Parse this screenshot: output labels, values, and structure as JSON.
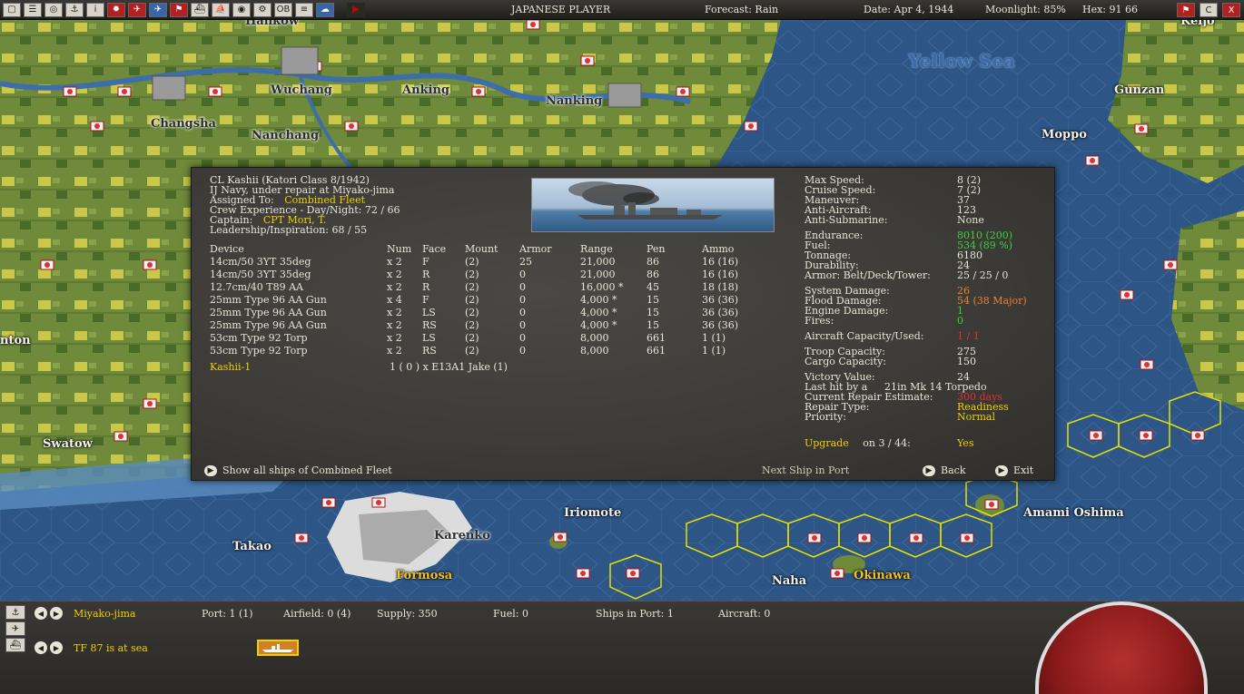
{
  "topbar": {
    "player": "JAPANESE PLAYER",
    "forecast": "Forecast: Rain",
    "date": "Date: Apr 4, 1944",
    "moonlight": "Moonlight: 85%",
    "hex": "Hex: 91  66",
    "buttons": [
      "menu-icon",
      "report-icon",
      "intel-icon",
      "tf-icon",
      "info-icon",
      "rising-sun-icon",
      "plane-icon",
      "ship-icon",
      "flag-icon",
      "carrier-icon",
      "sub-icon",
      "globe-icon",
      "gear-icon",
      "ob-icon",
      "list-icon",
      "cloud-icon",
      "play-icon"
    ],
    "right_buttons": [
      "flag-icon",
      "clock-icon",
      "close-icon"
    ],
    "ob_label": "OB",
    "info_label": "i",
    "c_label": "C",
    "x_label": "X"
  },
  "map": {
    "labels": {
      "hankow": "Hankow",
      "wuchang": "Wuchang",
      "anking": "Anking",
      "nanking": "Nanking",
      "changsha": "Changsha",
      "nanchang": "Nanchang",
      "yellow_sea": "Yellow Sea",
      "kunsan": "Gunzan",
      "moppo": "Moppo",
      "keijo": "Keijo",
      "swatow": "Swatow",
      "canton": "nton",
      "iriomote": "Iriomote",
      "karenko": "Karenko",
      "takao": "Takao",
      "formosa": "Formosa",
      "naha": "Naha",
      "okinawa": "Okinawa",
      "amami": "Amami Oshima"
    }
  },
  "ship": {
    "name_line": "CL Kashii (Katori Class 8/1942)",
    "status_line": "IJ Navy, under repair at Miyako-jima",
    "assigned_label": "Assigned To:",
    "assigned_value": "Combined Fleet",
    "crew_exp": "Crew Experience - Day/Night:  72 / 66",
    "captain_label": "Captain:",
    "captain_value": "CPT Mori, T.",
    "leadership": "Leadership/Inspiration: 68 / 55",
    "weapon_headers": [
      "Device",
      "Num",
      "Face",
      "Mount",
      "Armor",
      "Range",
      "Pen",
      "Ammo"
    ],
    "weapons": [
      [
        "14cm/50 3YT 35deg",
        "x 2",
        "F",
        "(2)",
        "25",
        "21,000",
        "86",
        "16  (16)"
      ],
      [
        "14cm/50 3YT 35deg",
        "x 2",
        "R",
        "(2)",
        "0",
        "21,000",
        "86",
        "16  (16)"
      ],
      [
        "12.7cm/40 T89 AA",
        "x 2",
        "R",
        "(2)",
        "0",
        "16,000 *",
        "45",
        "18  (18)"
      ],
      [
        "25mm Type 96 AA Gun",
        "x 4",
        "F",
        "(2)",
        "0",
        "4,000 *",
        "15",
        "36  (36)"
      ],
      [
        "25mm Type 96 AA Gun",
        "x 2",
        "LS",
        "(2)",
        "0",
        "4,000 *",
        "15",
        "36  (36)"
      ],
      [
        "25mm Type 96 AA Gun",
        "x 2",
        "RS",
        "(2)",
        "0",
        "4,000 *",
        "15",
        "36  (36)"
      ],
      [
        "53cm Type 92 Torp",
        "x 2",
        "LS",
        "(2)",
        "0",
        "8,000",
        "661",
        "1   (1)"
      ],
      [
        "53cm Type 92 Torp",
        "x 2",
        "RS",
        "(2)",
        "0",
        "8,000",
        "661",
        "1   (1)"
      ]
    ],
    "air_group_name": "Kashii-1",
    "air_group_value": "1 ( 0 ) x E13A1 Jake (1)",
    "stats": [
      {
        "label": "Max Speed:",
        "value": "8 (2)",
        "color": "#e8e4d8"
      },
      {
        "label": "Cruise Speed:",
        "value": "7 (2)",
        "color": "#e8e4d8"
      },
      {
        "label": "Maneuver:",
        "value": "37",
        "color": "#e8e4d8"
      },
      {
        "label": "Anti-Aircraft:",
        "value": "123",
        "color": "#e8e4d8"
      },
      {
        "label": "Anti-Submarine:",
        "value": "None",
        "color": "#e8e4d8"
      },
      {
        "label": "Endurance:",
        "value": "8010 (200)",
        "color": "#3cd03c"
      },
      {
        "label": "Fuel:",
        "value": "534 (89 %)",
        "color": "#3cd03c"
      },
      {
        "label": "Tonnage:",
        "value": "6180",
        "color": "#e8e4d8"
      },
      {
        "label": "Durability:",
        "value": "24",
        "color": "#e8e4d8"
      },
      {
        "label": "Armor: Belt/Deck/Tower:",
        "value": "25 / 25 / 0",
        "color": "#e8e4d8"
      },
      {
        "label": "System Damage:",
        "value": "26",
        "color": "#f08030"
      },
      {
        "label": "Flood Damage:",
        "value": "54   (38 Major)",
        "color": "#f08030"
      },
      {
        "label": "Engine Damage:",
        "value": "1",
        "color": "#3cd03c"
      },
      {
        "label": "Fires:",
        "value": "0",
        "color": "#3cd03c"
      },
      {
        "label": "Aircraft Capacity/Used:",
        "value": "1 / 1",
        "color": "#e03030"
      },
      {
        "label": "Troop Capacity:",
        "value": "275",
        "color": "#e8e4d8"
      },
      {
        "label": "Cargo Capacity:",
        "value": "150",
        "color": "#e8e4d8"
      },
      {
        "label": "Victory Value:",
        "value": "24",
        "color": "#e8e4d8"
      },
      {
        "label": "Last hit by a",
        "value": "21in Mk 14 Torpedo",
        "color": "#e8e4d8"
      },
      {
        "label": "Current Repair Estimate:",
        "value": "300 days",
        "color": "#e03030"
      },
      {
        "label": "Repair Type:",
        "value": "Readiness",
        "color": "#f0d000"
      },
      {
        "label": "Priority:",
        "value": "Normal",
        "color": "#f0d000"
      }
    ],
    "upgrade_label": "Upgrade",
    "upgrade_on": "on 3 / 44:",
    "upgrade_value": "Yes",
    "show_all": "Show all ships of Combined Fleet",
    "next_ship": "Next Ship in Port",
    "back": "Back",
    "exit": "Exit"
  },
  "bottom": {
    "location": "Miyako-jima",
    "port": "Port: 1 (1)",
    "airfield": "Airfield: 0 (4)",
    "supply": "Supply: 350",
    "fuel": "Fuel: 0",
    "ships_in_port": "Ships in Port: 1",
    "aircraft": "Aircraft: 0",
    "tf": "TF 87 is at sea"
  }
}
